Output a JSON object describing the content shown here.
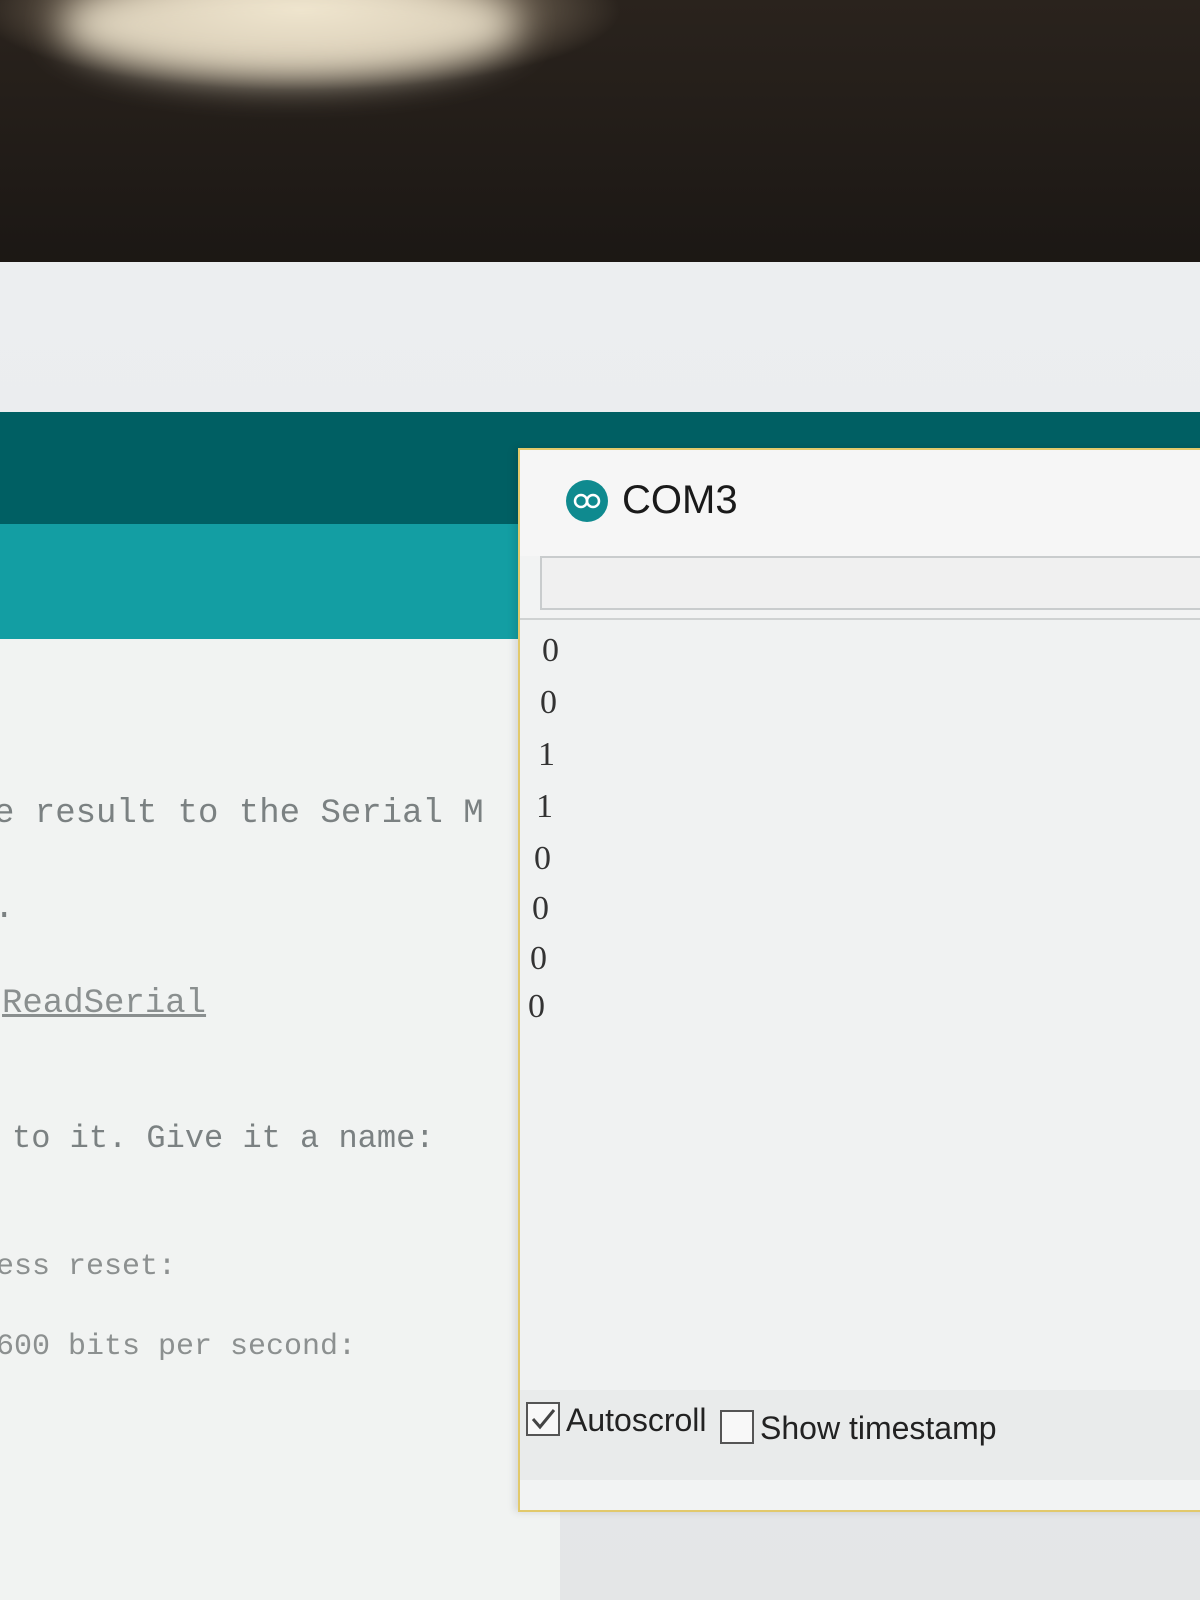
{
  "serial_monitor": {
    "title": "COM3",
    "icon": "arduino-infinity-icon",
    "send_input_value": "",
    "output_lines": [
      "0",
      "0",
      "1",
      "1",
      "0",
      "0",
      "0",
      "0"
    ],
    "autoscroll": {
      "label": "Autoscroll",
      "checked": true
    },
    "timestamp": {
      "label": "Show timestamp",
      "checked": false
    }
  },
  "editor": {
    "code_lines": [
      "e result to the Serial M",
      ".",
      "ReadSerial",
      "to it. Give it a name:",
      "ess reset:",
      "600 bits per second:"
    ]
  },
  "colors": {
    "header_dark": "#005f63",
    "header_teal": "#139ea3",
    "window_border": "#e2c96b"
  }
}
